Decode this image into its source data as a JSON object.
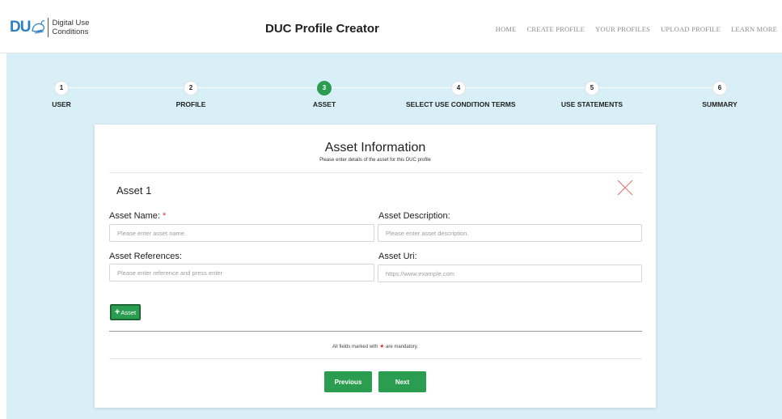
{
  "header": {
    "logo_mark": "DU",
    "logo_line1": "Digital Use",
    "logo_line2": "Conditions",
    "app_title": "DUC Profile Creator",
    "nav": [
      "HOME",
      "CREATE PROFILE",
      "YOUR PROFILES",
      "UPLOAD PROFILE",
      "LEARN MORE"
    ]
  },
  "stepper": {
    "active_step": 3,
    "steps": [
      {
        "number": "1",
        "label": "USER"
      },
      {
        "number": "2",
        "label": "PROFILE"
      },
      {
        "number": "3",
        "label": "ASSET"
      },
      {
        "number": "4",
        "label": "SELECT USE CONDITION TERMS"
      },
      {
        "number": "5",
        "label": "USE STATEMENTS"
      },
      {
        "number": "6",
        "label": "SUMMARY"
      }
    ]
  },
  "card": {
    "title": "Asset Information",
    "subtitle": "Please enter details of the asset for this DUC profile",
    "asset_heading": "Asset 1",
    "fields": {
      "asset_name": {
        "label": "Asset Name:",
        "required_marker": "*",
        "placeholder": "Please enter asset name.",
        "value": ""
      },
      "asset_description": {
        "label": "Asset Description:",
        "placeholder": "Please enter asset description.",
        "value": ""
      },
      "asset_references": {
        "label": "Asset References:",
        "placeholder": "Please enter reference and press enter",
        "value": ""
      },
      "asset_uri": {
        "label": "Asset Uri:",
        "placeholder": "https://www.example.com",
        "value": ""
      }
    },
    "add_asset_plus": "+",
    "add_asset_label": "Asset",
    "mandatory_prefix": "All fields marked with",
    "mandatory_star": "★",
    "mandatory_suffix": "are mandatory.",
    "previous_label": "Previous",
    "next_label": "Next"
  },
  "colors": {
    "accent_green": "#2a9d50",
    "page_background": "#d8eff7",
    "logo_blue": "#2b7fc2",
    "required_red": "#d9363e"
  },
  "icons": {
    "close": "close-icon",
    "logo": "dove-icon"
  }
}
